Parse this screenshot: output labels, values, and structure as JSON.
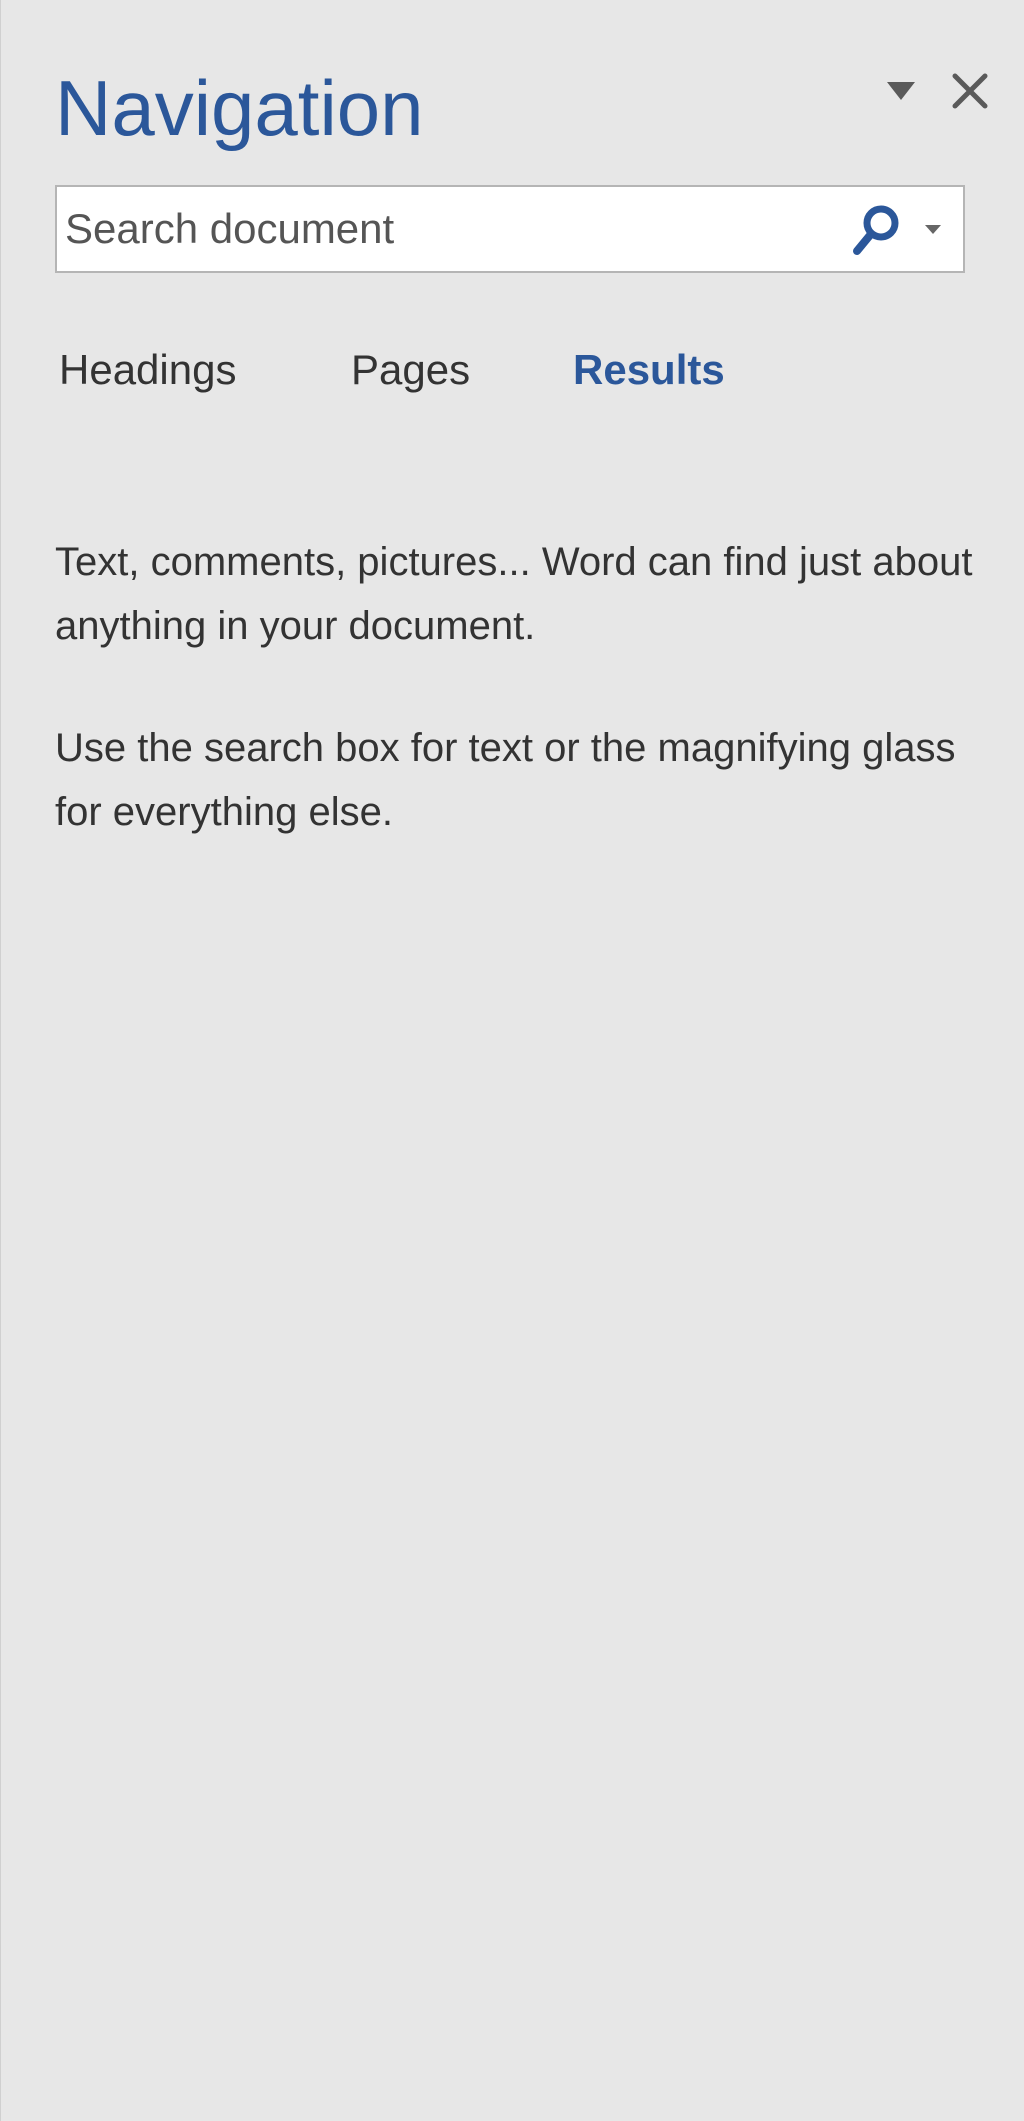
{
  "pane": {
    "title": "Navigation",
    "options_icon": "triangle-down-icon",
    "close_icon": "close-icon"
  },
  "search": {
    "placeholder": "Search document",
    "value": "",
    "search_icon": "magnifier-icon",
    "dropdown_icon": "chevron-down-icon"
  },
  "tabs": [
    {
      "label": "Headings",
      "active": false
    },
    {
      "label": "Pages",
      "active": false
    },
    {
      "label": "Results",
      "active": true
    }
  ],
  "results": {
    "message_1": "Text, comments, pictures... Word can find just about anything in your document.",
    "message_2": "Use the search box for text or the magnifying glass for everything else."
  },
  "colors": {
    "accent": "#2b579a",
    "background": "#e7e7e7",
    "text": "#333333"
  }
}
